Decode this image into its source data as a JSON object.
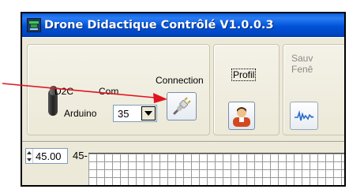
{
  "window": {
    "title": "Drone Didactique Contrôlé  V1.0.0.3"
  },
  "connection_group": {
    "d2c_label": "D2C",
    "com_label": "Com",
    "arduino_label": "Arduino",
    "com_value": "35",
    "connection_label": "Connection",
    "connection_icon": "plug-icon"
  },
  "profil_group": {
    "label": "Profil",
    "icon": "user-avatar-icon"
  },
  "save_group": {
    "label_line1": "Sauv",
    "label_line2": "Fenê",
    "icon": "waveform-icon"
  },
  "graph_area": {
    "spin_value": "45.00",
    "axis_label": "45-"
  },
  "annotation": {
    "arrow_color": "#e0141e"
  }
}
